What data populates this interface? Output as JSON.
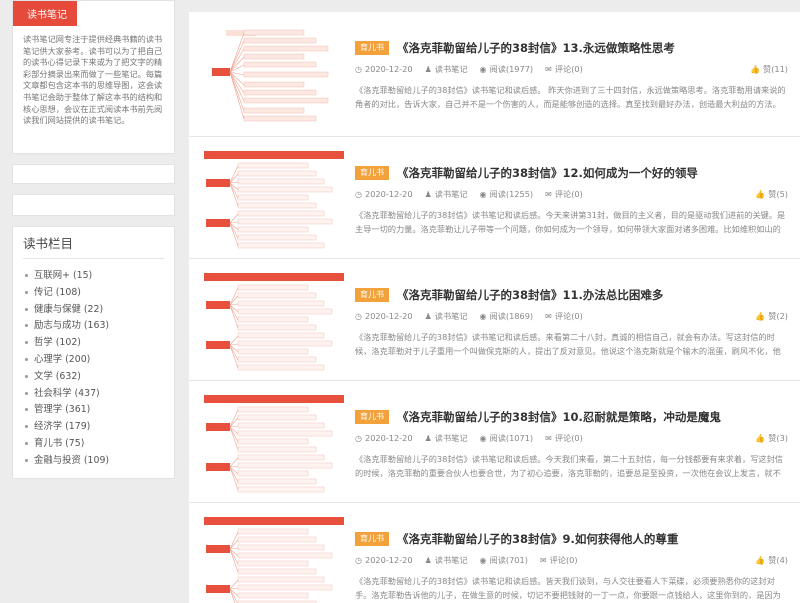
{
  "sidebar": {
    "about": {
      "title": "读书笔记",
      "text": "读书笔记网专注于提供经典书籍的读书笔记供大家参考。读书可以为了把自己的读书心得记录下来或为了把文字的精彩部分摘录出来而做了一些笔记。每篇文章都包含这本书的思维导图，这会读书笔记会助于整体了解这本书的结构和核心思想，会议在正式阅读本书前先阅读我们网站提供的读书笔记。"
    },
    "categories": {
      "title": "读书栏目",
      "items": [
        {
          "label": "互联网+",
          "count": "(15)"
        },
        {
          "label": "传记",
          "count": "(108)"
        },
        {
          "label": "健康与保健",
          "count": "(22)"
        },
        {
          "label": "励志与成功",
          "count": "(163)"
        },
        {
          "label": "哲学",
          "count": "(102)"
        },
        {
          "label": "心理学",
          "count": "(200)"
        },
        {
          "label": "文学",
          "count": "(632)"
        },
        {
          "label": "社会科学",
          "count": "(437)"
        },
        {
          "label": "管理学",
          "count": "(361)"
        },
        {
          "label": "经济学",
          "count": "(179)"
        },
        {
          "label": "育儿书",
          "count": "(75)"
        },
        {
          "label": "金融与投资",
          "count": "(109)"
        }
      ]
    }
  },
  "posts": [
    {
      "tag": "育儿书",
      "title": "《洛克菲勒留给儿子的38封信》13.永远做策略性思考",
      "date": "2020-12-20",
      "author": "读书笔记",
      "views": "阅读(1977)",
      "comments": "评论(0)",
      "likes": "赞(11)",
      "excerpt": "《洛克菲勒留给儿子的38封信》读书笔记和读后感。 昨天你进到了三十四封信，永远做策略思考。洛克菲勒用请来说的角者的对比，告诉大家，自己并不是一个伤害的人，而是能够创造的选择。真至找到最好办法，创造最大利益的方法。这就是他能赚到大钱的..."
    },
    {
      "tag": "育儿书",
      "title": "《洛克菲勒留给儿子的38封信》12.如何成为一个好的领导",
      "date": "2020-12-20",
      "author": "读书笔记",
      "views": "阅读(1255)",
      "comments": "评论(0)",
      "likes": "赞(5)",
      "excerpt": "《洛克菲勒留给儿子的38封信》读书笔记和读后感。今天来讲第31封，做目的主义者，目的是驱动我们进前的关键。是主导一切的力量。洛克菲勒让儿子带等一个问题，你如何成为一个领导，如何带领大家面对诸多困难。比如维积如山的工作，外面诡谲的是识以..."
    },
    {
      "tag": "育儿书",
      "title": "《洛克菲勒留给儿子的38封信》11.办法总比困难多",
      "date": "2020-12-20",
      "author": "读书笔记",
      "views": "阅读(1869)",
      "comments": "评论(0)",
      "likes": "赞(2)",
      "excerpt": "《洛克菲勒留给儿子的38封信》读书笔记和读后感。来看第二十八封，真诚的相信自己，就会有办法。写这封信的时候，洛克菲勒对于儿子重用一个叫做保克斯的人，提出了反对意见。他说这个洛克斯就是个输木的混蛋，刷风不化，他不喜思考，也没有解决手段..."
    },
    {
      "tag": "育儿书",
      "title": "《洛克菲勒留给儿子的38封信》10.忍耐就是策略，冲动是魔鬼",
      "date": "2020-12-20",
      "author": "读书笔记",
      "views": "阅读(1071)",
      "comments": "评论(0)",
      "likes": "赞(3)",
      "excerpt": "《洛克菲勒留给儿子的38封信》读书笔记和读后感。今天我们来看，第二十五封信，每一分钱都要有来求着，写这封信的时候，洛克菲勒的重要合伙人也要合世，为了初心追要，洛克菲勒的，追要总是至投资，一次他在会议上发言，就不要说既在该做什么，要说我们..."
    },
    {
      "tag": "育儿书",
      "title": "《洛克菲勒留给儿子的38封信》9.如何获得他人的尊重",
      "date": "2020-12-20",
      "author": "读书笔记",
      "views": "阅读(701)",
      "comments": "评论(0)",
      "likes": "赞(4)",
      "excerpt": "《洛克菲勒留给儿子的38封信》读书笔记和读后感。皆天我们谈到，与人交往要看人下菜碟，必须要熟悉你的这封对手。洛克菲勒告诉他的儿子，在做生意的时候，切记不要把钱财的一丁一点，你要跟一点钱给人，这里你到的，是因为他的，我们对方..."
    }
  ],
  "colors": {
    "accent_red": "#e64a3b",
    "tag_orange": "#f3a23b"
  }
}
